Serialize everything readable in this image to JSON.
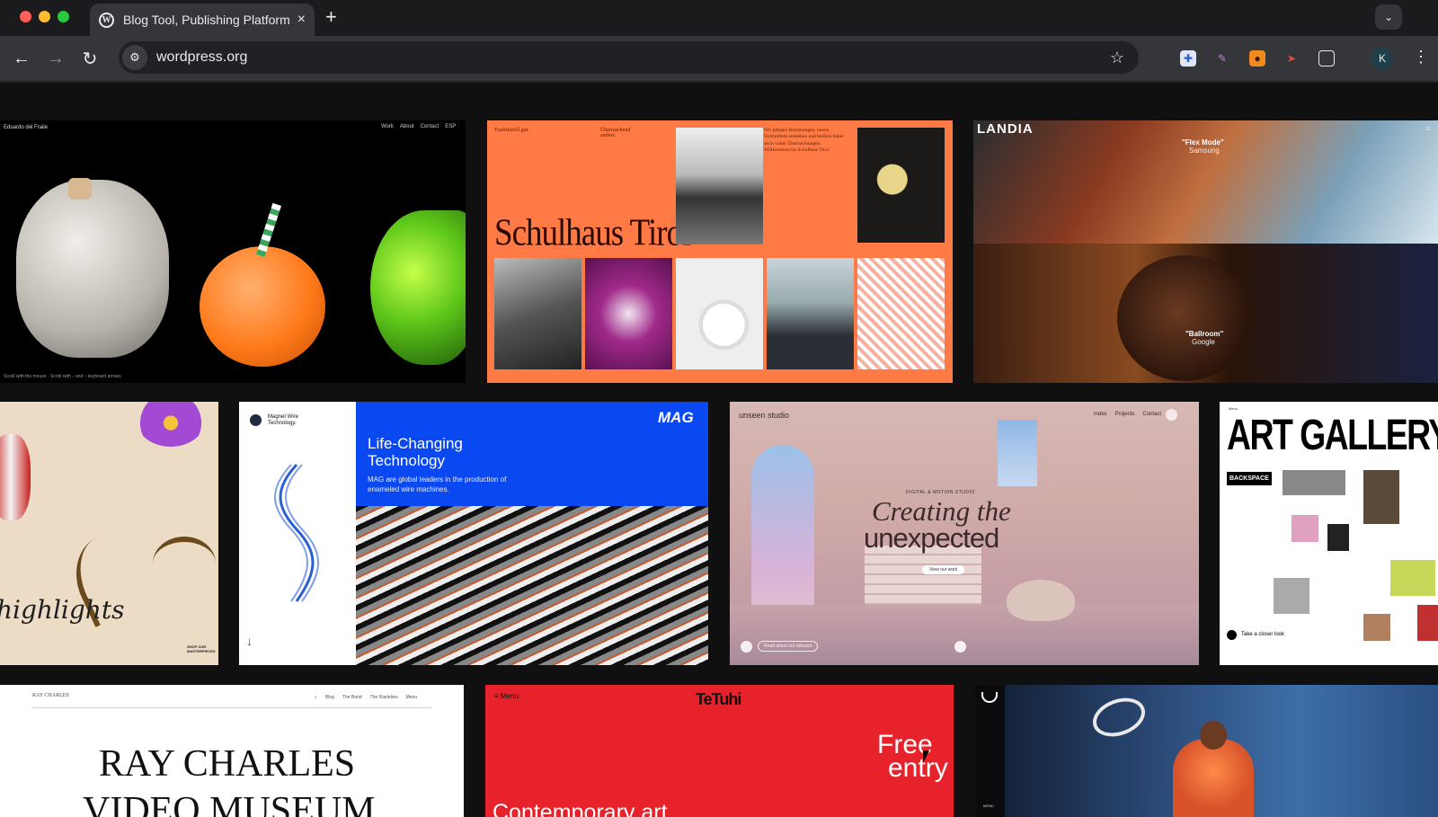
{
  "browser": {
    "tab_title": "Blog Tool, Publishing Platform",
    "tab_close": "×",
    "new_tab": "+",
    "url": "wordpress.org",
    "avatar_letter": "K",
    "colors": {
      "red": "#ff5f57",
      "yellow": "#febc2e",
      "green": "#28c840"
    }
  },
  "showcase": {
    "card1": {
      "name": "Eduardo del Fraile",
      "nav": [
        "Work",
        "About",
        "Contact",
        "ESP"
      ],
      "footer": "Scroll with the mouse · Scroll with ↓ and ↑ keyboard arrows"
    },
    "card2": {
      "headline": "Schulhaus Tirol",
      "col1": "Traditionell gut.",
      "col2": "Überraschend anders.",
      "col3": "Wir pflegen Beziehungen, lassen Vertrautheit entstehen und bleiben dabei doch voller Überraschungen. Willkommen im Schulhaus Tirol."
    },
    "card3": {
      "logo": "LANDIA",
      "quote1": "\"Flex Mode\"",
      "client1": "Samsung",
      "quote2": "\"Ballroom\"",
      "client2": "Google"
    },
    "card4": {
      "script": "highlights",
      "corner": "SHOP OUR MASTERPIECES"
    },
    "card5": {
      "brand": "Magnet Wire Technology.",
      "heading": "Life-Changing Technology",
      "body": "MAG are global leaders in the production of enameled wire machines.",
      "logo": "MAG",
      "arrow": "↓"
    },
    "card6": {
      "logo": "unseen studio",
      "nav": [
        "Index",
        "Projects",
        "Contact"
      ],
      "eyebrow": "DIGITAL & MOTION STUDIO",
      "line1": "Creating the",
      "line2": "unexpected",
      "cta": "View our work",
      "rebrand": "Read about our rebrand"
    },
    "card7": {
      "heading": "ART GALLERY",
      "sticker": "BACKSPACE",
      "cta": "Take a closer look",
      "corner": "Menu"
    },
    "card8": {
      "title": "RAY CHARLES",
      "subtitle": "VIDEO MUSEUM",
      "nav": [
        "Blog",
        "The Band",
        "The Raelettes",
        "Menu"
      ],
      "small": "RAY CHARLES"
    },
    "card9": {
      "logo": "TeTuhi",
      "menu": "Menu",
      "free1": "Free",
      "free2": "entry",
      "bottom": "Contemporary art"
    },
    "card10": {
      "menu": "MENU"
    }
  }
}
